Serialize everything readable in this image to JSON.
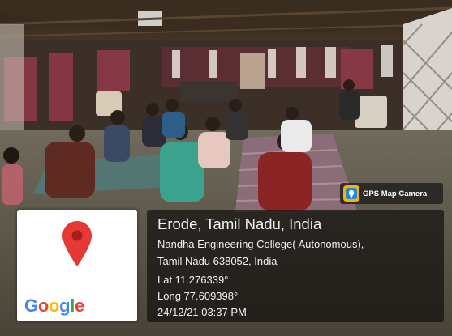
{
  "badge": {
    "label": "GPS Map Camera",
    "icon": "gps-map-camera-icon"
  },
  "map": {
    "logo": "Google",
    "pin_icon": "map-pin-icon",
    "pin_color": "#e53935"
  },
  "location": {
    "city": "Erode, Tamil Nadu, India",
    "address_line1": "Nandha Engineering College( Autonomous),",
    "address_line2": "Tamil Nadu 638052, India",
    "latitude": "Lat 11.276339°",
    "longitude": "Long 77.609398°",
    "datetime": "24/12/21 03:37 PM"
  },
  "colors": {
    "google_blue": "#4285F4",
    "google_red": "#EA4335",
    "google_yellow": "#FBBC05",
    "google_green": "#34A853"
  }
}
